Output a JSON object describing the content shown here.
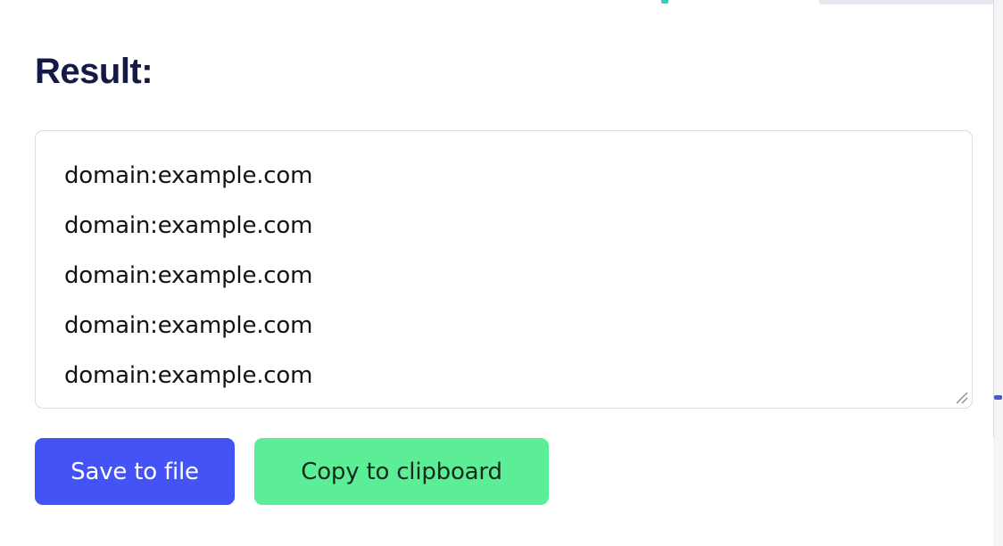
{
  "page": {
    "background_color": "#ffffff",
    "heading": "Result:"
  },
  "result": {
    "textarea_name": "result-output",
    "lines": [
      "domain:example.com",
      "domain:example.com",
      "domain:example.com",
      "domain:example.com",
      "domain:example.com"
    ],
    "resize_grip_icon": "resize-handle-icon"
  },
  "actions": {
    "save_label": "Save to file",
    "save_color": "#4453f6",
    "save_text_color": "#ffffff",
    "copy_label": "Copy to clipboard",
    "copy_color": "#5cee96",
    "copy_text_color": "#16291f"
  },
  "chrome": {
    "heading_color": "#141a45",
    "textarea_border_color": "#dcdde3",
    "scrollbar_track_color": "#f5f5f7",
    "scrollbar_thumb_color": "#4b57d6",
    "top_strip_teal_color": "#3ec9bd",
    "top_strip_gray_color": "#e6e7ee"
  }
}
